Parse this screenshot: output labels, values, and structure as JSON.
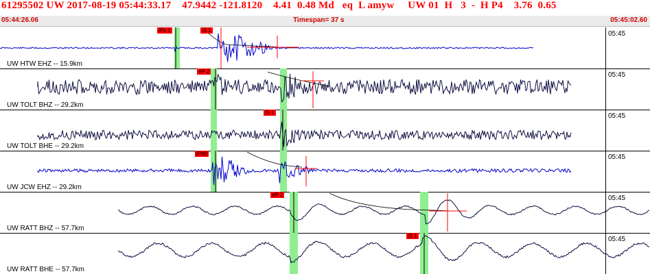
{
  "header": {
    "title": "61295502 UW 2017-08-19 05:44:33.17    47.9442 -121.8120    4.41  0.48 Md   eq  L amyw     UW 01  H   3  -  H P4    3.76  0.65",
    "start_time": "05:44:26.06",
    "timespan": "Timespan=  37 s",
    "end_time": "05:45:02.60"
  },
  "colors": {
    "trace_blue": "#0000cc",
    "trace_dark": "#0d0d40",
    "pick_red": "#ff0000",
    "window_green": "#90ee90"
  },
  "traces": [
    {
      "label": "UW HTW EHZ -- 15.9km",
      "time": "05:45",
      "color": "blue",
      "picks": [
        "iPc 1",
        "iS 1"
      ]
    },
    {
      "label": "UW TOLT BHZ -- 29.2km",
      "time": "05:45",
      "color": "dark",
      "picks": [
        "eP 2"
      ]
    },
    {
      "label": "UW TOLT BHE -- 29.2km",
      "time": "05:45",
      "color": "dark",
      "picks": [
        "iS 1"
      ]
    },
    {
      "label": "UW JCW EHZ -- 29.2km",
      "time": "05:45",
      "color": "blue",
      "picks": [
        "iPd0"
      ]
    },
    {
      "label": "UW RATT BHZ -- 57.7km",
      "time": "05:45",
      "color": "dark",
      "picks": [
        "eP 2"
      ]
    },
    {
      "label": "UW RATT BHE -- 57.7km",
      "time": "05:45",
      "color": "dark",
      "picks": [
        "iS 1"
      ]
    }
  ]
}
